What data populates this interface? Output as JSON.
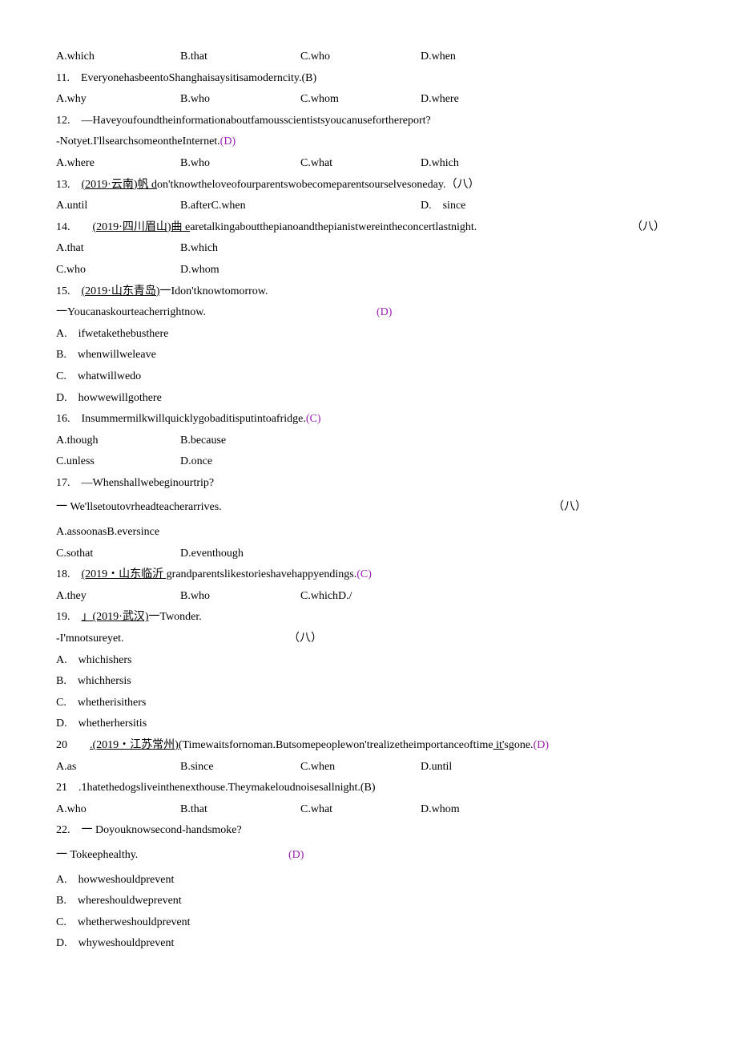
{
  "q10_opts": {
    "a": "A.which",
    "b": "B.that",
    "c": "C.who",
    "d": "D.when"
  },
  "q11": {
    "stem": "11.　EveryonehasbeentoShanghaisaysitisamoderncity.(B)",
    "opts": {
      "a": "A.why",
      "b": "B.who",
      "c": "C.whom",
      "d": "D.where"
    }
  },
  "q12": {
    "stem1": "12.　—Haveyoufoundtheinformationaboutfamousscientistsyoucanuseforthereport?",
    "stem2_pre": "-Notyet.I'llsearchsomeontheInternet.",
    "ans": "(D)",
    "opts": {
      "a": "A.where",
      "b": "B.who",
      "c": "C.what",
      "d": "D.which"
    }
  },
  "q13": {
    "stem_pre": "13.　",
    "stem_u": "(2019·云南)帆 d",
    "stem_post": "on'tknowtheloveofourparentswobecomeparentsourselvesoneday.（八）",
    "opts": {
      "a": "A.until",
      "bc": "B.afterC.when",
      "d": "D.　since"
    }
  },
  "q14": {
    "stem_pre": "14.　　",
    "stem_u": "(2019·四川眉山)曲 e",
    "stem_post": "aretalkingaboutthepianoandthepianistwereintheconcertlastnight.",
    "ans": "（八）",
    "opts1": {
      "a": "A.that",
      "b": "B.which"
    },
    "opts2": {
      "c": "C.who",
      "d": "D.whom"
    }
  },
  "q15": {
    "stem_pre": "15.　",
    "stem_u": "(2019·山东青岛)",
    "stem_post": "一Idon'tknowtomorrow.",
    "line2": "一Youcanaskourteacherrightnow.",
    "ans": "(D)",
    "a": "A.　ifwetakethebusthere",
    "b": "B.　whenwillweleave",
    "c": "C.　whatwillwedo",
    "d": "D.　howwewillgothere"
  },
  "q16": {
    "stem_pre": "16.　Insummermilkwillquicklygobaditisputintoafridge.",
    "ans": "(C)",
    "opts1": {
      "a": "A.though",
      "b": "B.because"
    },
    "opts2": {
      "c": "C.unless",
      "d": "D.once"
    }
  },
  "q17": {
    "stem": "17.　—Whenshallwebeginourtrip?",
    "line2": "一 We'llsetoutovrheadteacherarrives.",
    "ans": "（八）",
    "opts1": "A.assoonasB.eversince",
    "opts2": {
      "c": "C.sothat",
      "d": "D.eventhough"
    }
  },
  "q18": {
    "stem_pre": "18.　",
    "stem_u": "(2019・山东临沂 g",
    "stem_post": "randparentslikestorieshavehappyendings.",
    "ans": "(C)",
    "opts": {
      "a": "A.they",
      "b": "B.who",
      "cd": "C.whichD./"
    }
  },
  "q19": {
    "stem_pre": "19.　",
    "stem_u": "」(2019·武汉)",
    "stem_post": "一Twonder.",
    "line2": "-I'mnotsureyet.",
    "ans": "（八）",
    "a": "A.　whichishers",
    "b": "B.　whichhersis",
    "c": "C.　whetherisithers",
    "d": "D.　whetherhersitis"
  },
  "q20": {
    "stem_pre": "20　　",
    "stem_u": ".(2019・江苏常州)(",
    "stem_post_pre": "Timewaitsfornoman.Butsomepeoplewon'trealizetheimportanceoftime",
    "stem_u2": " it'",
    "stem_post2": "sgone.",
    "ans": "(D)",
    "opts": {
      "a": "A.as",
      "b": "B.since",
      "c": "C.when",
      "d": "D.until"
    }
  },
  "q21": {
    "stem": "21　.1hatethedogsliveinthenexthouse.Theymakeloudnoisesallnight.(B)",
    "opts": {
      "a": "A.who",
      "b": "B.that",
      "c": "C.what",
      "d": "D.whom"
    }
  },
  "q22": {
    "stem": "22.　一 Doyouknowsecond-handsmoke?",
    "line2": "一 Tokeephealthy.",
    "ans": "(D)",
    "a": "A.　howweshouldprevent",
    "b": "B.　whereshouldweprevent",
    "c": "C.　whetherweshouldprevent",
    "d": "D.　whyweshouldprevent"
  }
}
